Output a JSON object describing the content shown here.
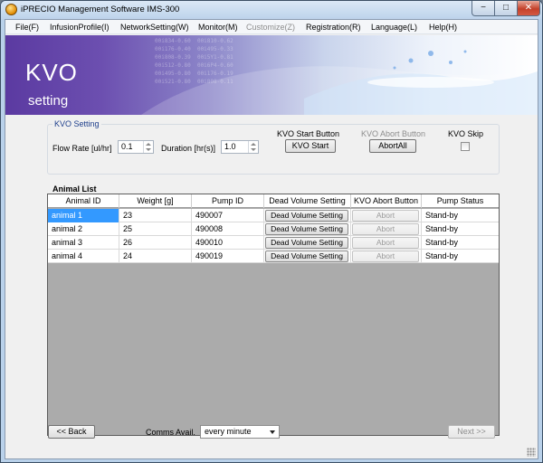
{
  "window": {
    "title": "iPRECIO Management Software IMS-300",
    "minimize_glyph": "−",
    "maximize_glyph": "□",
    "close_glyph": "✕"
  },
  "menu": [
    {
      "label": "File(F)"
    },
    {
      "label": "InfusionProfile(I)"
    },
    {
      "label": "NetworkSetting(W)"
    },
    {
      "label": "Monitor(M)"
    },
    {
      "label": "Customize(Z)"
    },
    {
      "label": "Registration(R)"
    },
    {
      "label": "Language(L)"
    },
    {
      "label": "Help(H)"
    }
  ],
  "banner": {
    "title": "KVO",
    "subtitle": "setting"
  },
  "kvo_setting": {
    "group_label": "KVO Setting",
    "flow_rate_label": "Flow Rate [ul/hr]",
    "flow_rate_value": "0.1",
    "duration_label": "Duration [hr(s)]",
    "duration_value": "1.0",
    "start_label": "KVO Start Button",
    "start_button": "KVO Start",
    "abort_label": "KVO Abort Button",
    "abort_button": "AbortAll",
    "skip_label": "KVO Skip",
    "skip_checked": false
  },
  "animal_list": {
    "label": "Animal List",
    "columns": [
      "Animal ID",
      "Weight [g]",
      "Pump ID",
      "Dead Volume Setting",
      "KVO Abort Button",
      "Pump Status"
    ],
    "rows": [
      {
        "animal_id": "animal 1",
        "weight": "23",
        "pump_id": "490007",
        "dead_volume": "Dead Volume Setting",
        "abort": "Abort",
        "status": "Stand-by"
      },
      {
        "animal_id": "animal 2",
        "weight": "25",
        "pump_id": "490008",
        "dead_volume": "Dead Volume Setting",
        "abort": "Abort",
        "status": "Stand-by"
      },
      {
        "animal_id": "animal 3",
        "weight": "26",
        "pump_id": "490010",
        "dead_volume": "Dead Volume Setting",
        "abort": "Abort",
        "status": "Stand-by"
      },
      {
        "animal_id": "animal 4",
        "weight": "24",
        "pump_id": "490019",
        "dead_volume": "Dead Volume Setting",
        "abort": "Abort",
        "status": "Stand-by"
      }
    ]
  },
  "footer": {
    "back_button": "<< Back",
    "comms_label": "Comms Avail.",
    "comms_value": "every  minute",
    "next_button": "Next >>"
  },
  "colors": {
    "selection": "#3399ff",
    "group_label": "#1e3f8c",
    "banner_purple": "#5b3aa1"
  }
}
